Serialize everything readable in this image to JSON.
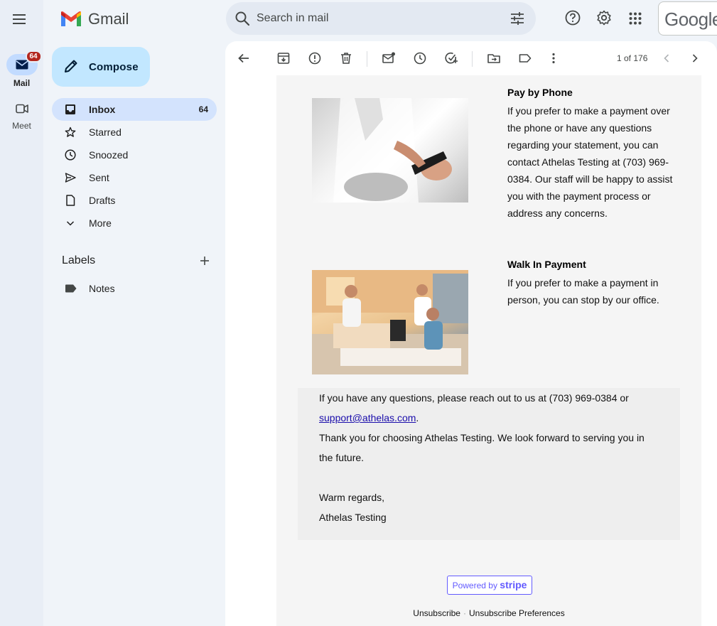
{
  "app": {
    "name": "Gmail",
    "google_label": "Google",
    "search_placeholder": "Search in mail"
  },
  "rail": {
    "mail_label": "Mail",
    "mail_badge": "64",
    "meet_label": "Meet"
  },
  "compose_label": "Compose",
  "nav": [
    {
      "label": "Inbox",
      "count": "64",
      "active": true,
      "icon": "inbox-icon"
    },
    {
      "label": "Starred",
      "icon": "star-icon"
    },
    {
      "label": "Snoozed",
      "icon": "clock-icon"
    },
    {
      "label": "Sent",
      "icon": "send-icon"
    },
    {
      "label": "Drafts",
      "icon": "draft-icon"
    },
    {
      "label": "More",
      "icon": "chevron-down-icon"
    }
  ],
  "labels": {
    "title": "Labels",
    "items": [
      {
        "label": "Notes",
        "icon": "label-icon"
      }
    ]
  },
  "toolbar": {
    "pager": "1 of 176"
  },
  "email": {
    "pay_phone": {
      "title": "Pay by Phone",
      "body": "If you prefer to make a payment over the phone or have any questions regarding your statement, you can contact Athelas Testing at (703) 969-0384. Our staff will be happy to assist you with the payment process or address any concerns."
    },
    "walk_in": {
      "title": "Walk In Payment",
      "body": "If you prefer to make a payment in person, you can stop by our office."
    },
    "footer": {
      "questions_prefix": "If you have any questions, please reach out to us at (703) 969-0384 or",
      "support_email": "support@athelas.com",
      "questions_suffix": ".",
      "thanks": "Thank you for choosing Athelas Testing. We look forward to serving you in the future.",
      "regards": "Warm regards,",
      "signature": "Athelas Testing"
    },
    "powered_by": "Powered by",
    "stripe_brand": "stripe",
    "unsubscribe": "Unsubscribe",
    "unsubscribe_prefs": "Unsubscribe Preferences"
  },
  "colors": {
    "accent": "#c2e7ff",
    "active_nav": "#d3e3fd",
    "badge": "#b3261e",
    "stripe": "#635bff"
  }
}
